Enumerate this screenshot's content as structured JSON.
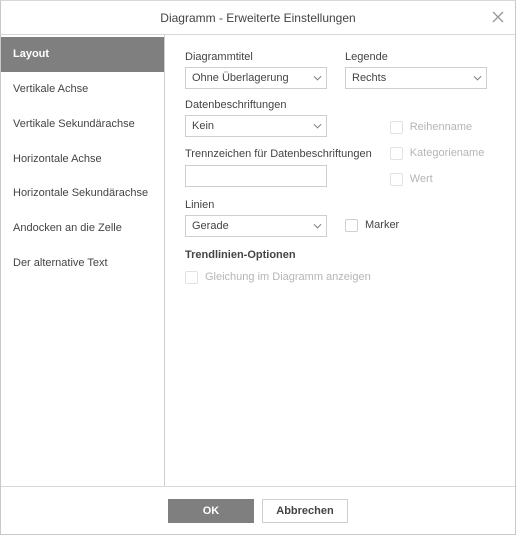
{
  "dialog": {
    "title": "Diagramm - Erweiterte Einstellungen"
  },
  "tabs": [
    "Layout",
    "Vertikale Achse",
    "Vertikale Sekundärachse",
    "Horizontale Achse",
    "Horizontale Sekundärachse",
    "Andocken an die Zelle",
    "Der alternative Text"
  ],
  "layout": {
    "chartTitle": {
      "label": "Diagrammtitel",
      "value": "Ohne Überlagerung"
    },
    "legend": {
      "label": "Legende",
      "value": "Rechts"
    },
    "dataLabels": {
      "label": "Datenbeschriftungen",
      "value": "Kein"
    },
    "separator": {
      "label": "Trennzeichen für Datenbeschriftungen",
      "value": ""
    },
    "lines": {
      "label": "Linien",
      "value": "Gerade"
    },
    "checks": {
      "seriesName": "Reihenname",
      "categoryName": "Kategoriename",
      "value": "Wert",
      "marker": "Marker"
    },
    "trend": {
      "title": "Trendlinien-Optionen",
      "showEq": "Gleichung im Diagramm anzeigen"
    }
  },
  "buttons": {
    "ok": "OK",
    "cancel": "Abbrechen"
  }
}
